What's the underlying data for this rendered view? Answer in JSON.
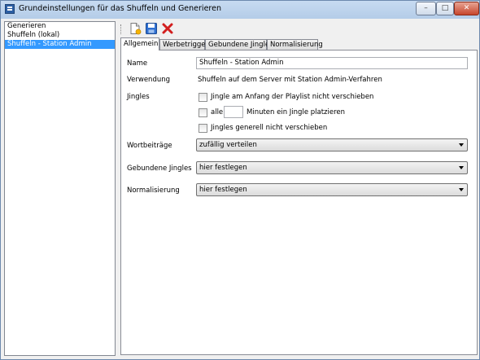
{
  "window": {
    "title": "Grundeinstellungen für das Shuffeln und Generieren",
    "controls": {
      "minimize": "–",
      "maximize": "□",
      "close": "✕"
    }
  },
  "sidebar": {
    "items": [
      {
        "label": "Generieren",
        "selected": false
      },
      {
        "label": "Shuffeln (lokal)",
        "selected": false
      },
      {
        "label": "Shuffeln - Station Admin",
        "selected": true
      }
    ]
  },
  "toolbar": {
    "buttons": [
      {
        "icon": "new-document-icon"
      },
      {
        "icon": "save-disk-icon"
      },
      {
        "icon": "delete-x-icon"
      }
    ]
  },
  "tabs": [
    {
      "label": "Allgemein",
      "active": true
    },
    {
      "label": "Werbetrigger",
      "active": false
    },
    {
      "label": "Gebundene Jingles",
      "active": false
    },
    {
      "label": "Normalisierung",
      "active": false
    }
  ],
  "form": {
    "name": {
      "label": "Name",
      "value": "Shuffeln - Station Admin"
    },
    "verwendung": {
      "label": "Verwendung",
      "value": "Shuffeln auf dem Server mit Station Admin-Verfahren"
    },
    "jingles": {
      "label": "Jingles",
      "option1": {
        "label": "Jingle am Anfang der Playlist nicht verschieben",
        "checked": false
      },
      "option2": {
        "prefix": "alle",
        "value": "",
        "suffix": "Minuten ein Jingle platzieren",
        "checked": false
      },
      "option3": {
        "label": "Jingles generell nicht verschieben",
        "checked": false
      }
    },
    "wortbeitraege": {
      "label": "Wortbeiträge",
      "value": "zufällig verteilen"
    },
    "gebundene_jingles": {
      "label": "Gebundene Jingles",
      "value": "hier festlegen"
    },
    "normalisierung": {
      "label": "Normalisierung",
      "value": "hier festlegen"
    }
  }
}
